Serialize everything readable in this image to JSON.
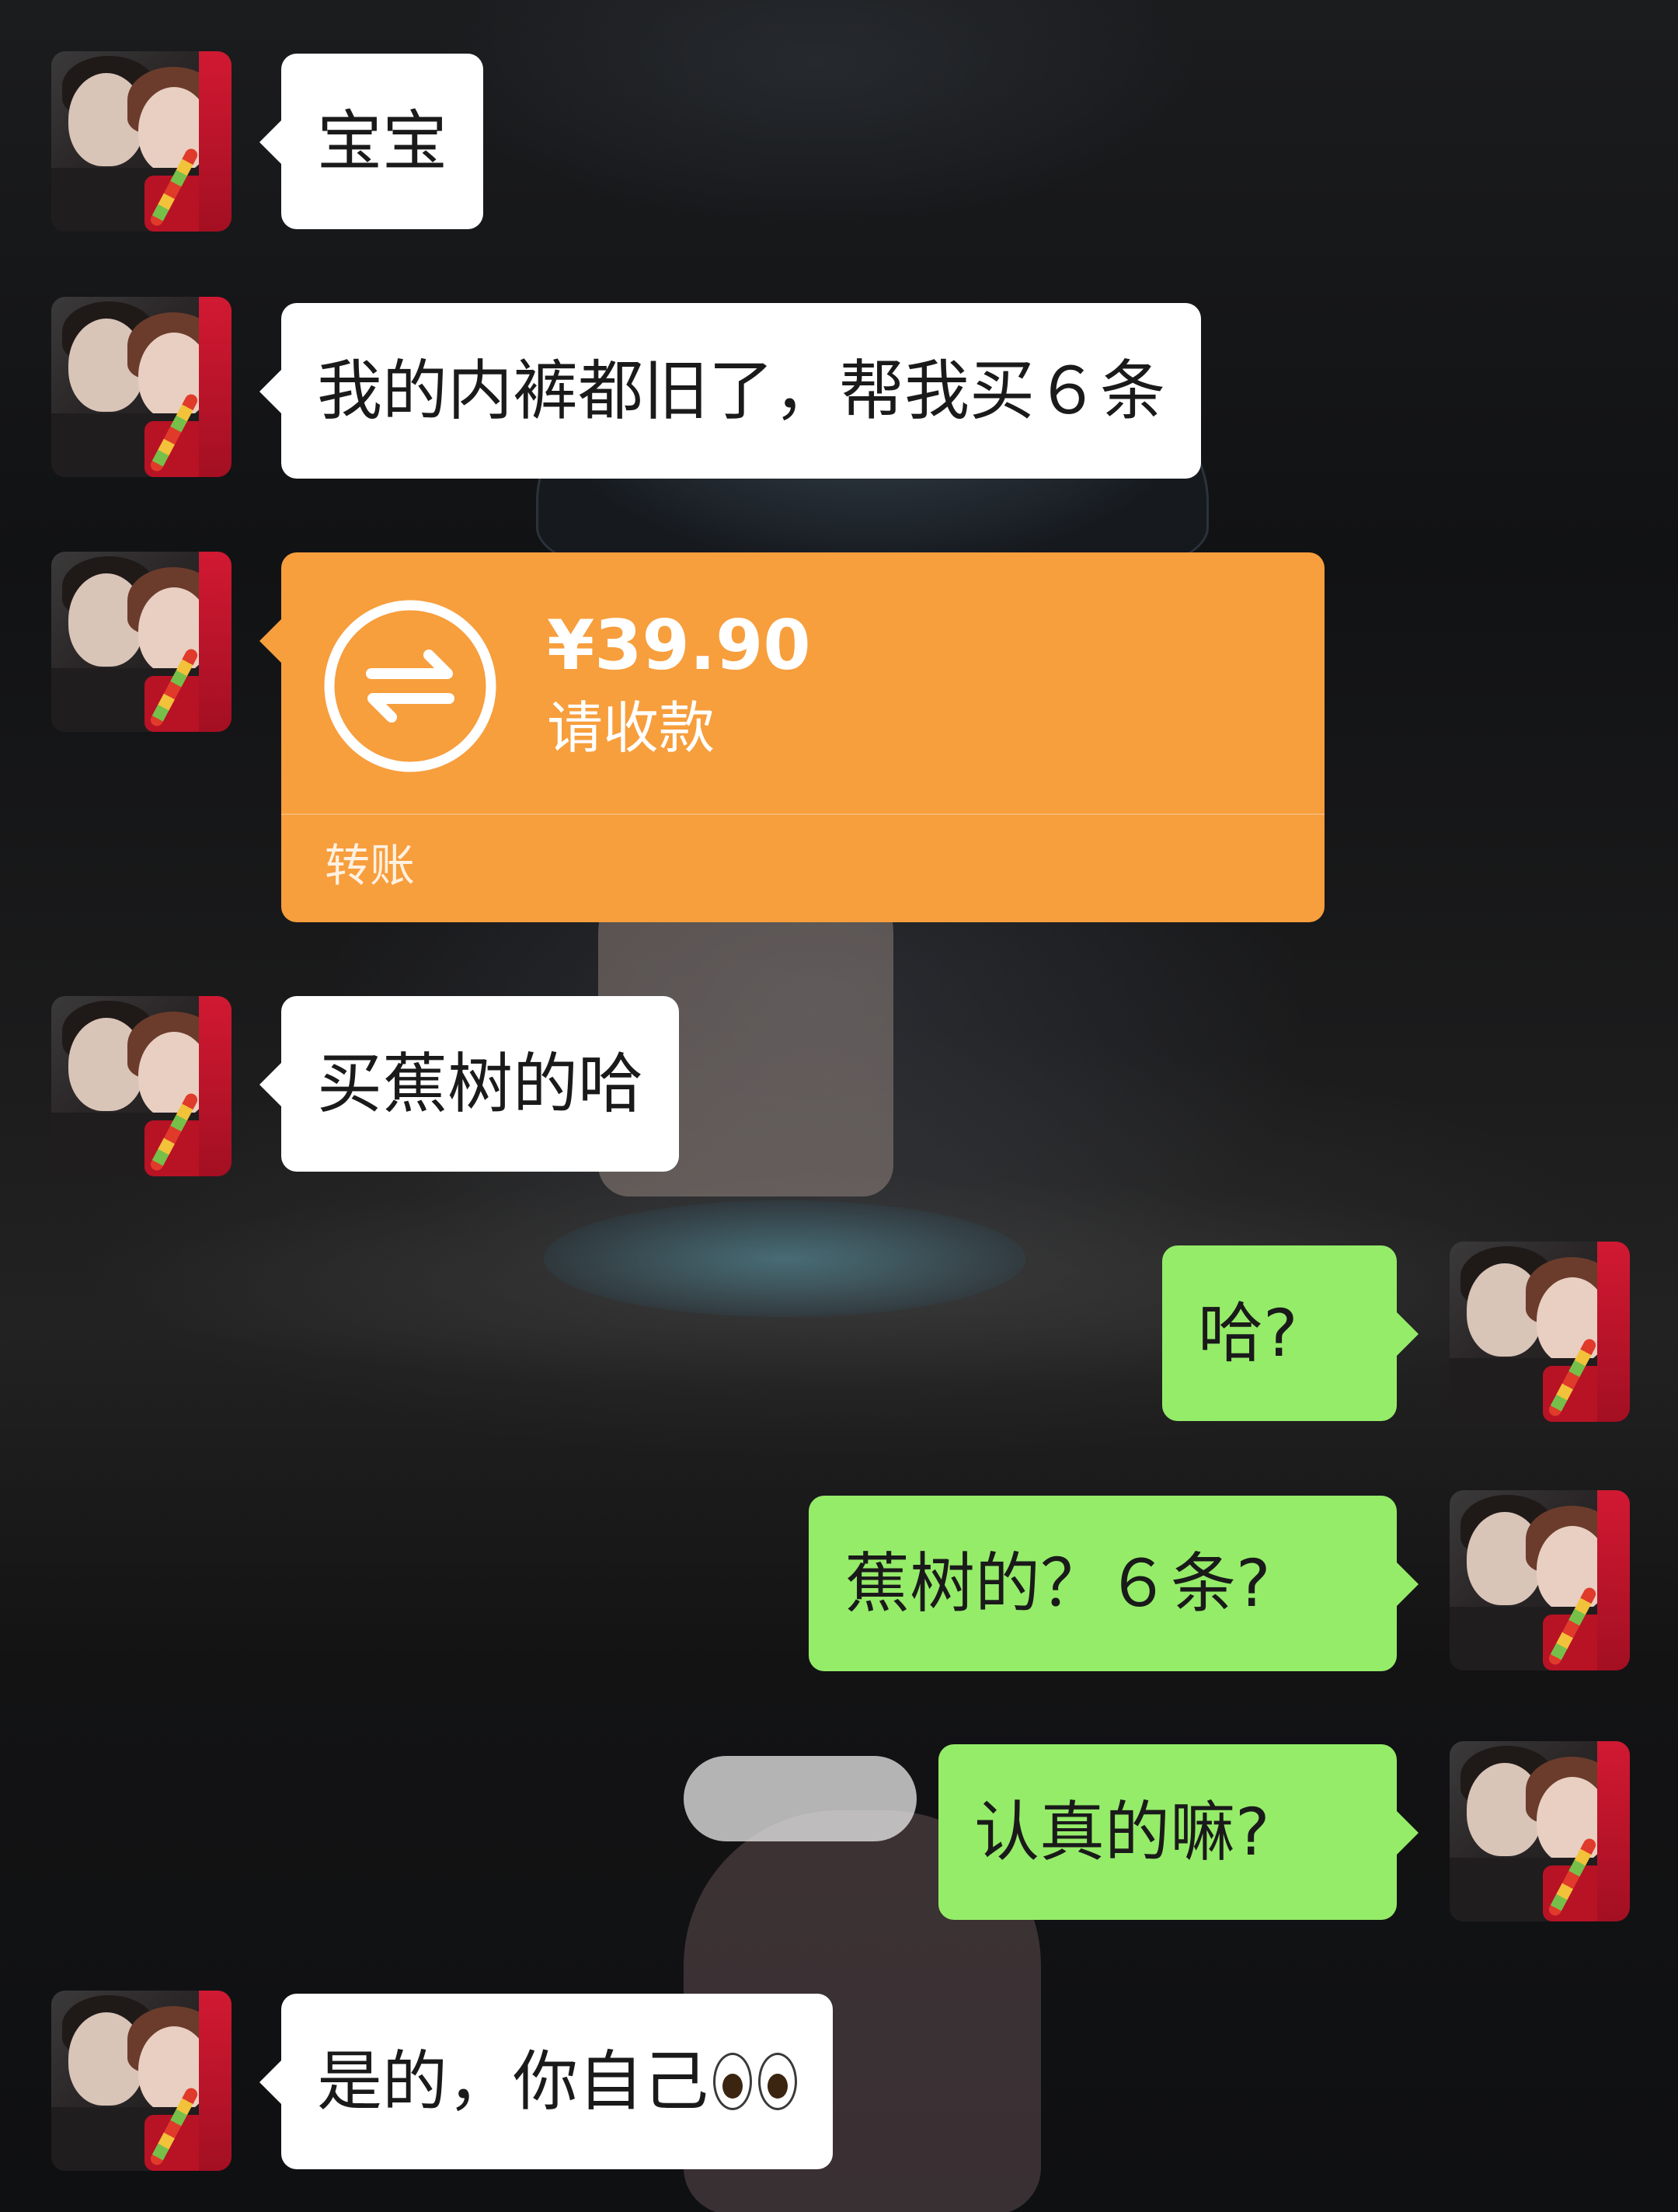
{
  "colors": {
    "incoming_bubble": "#ffffff",
    "outgoing_bubble": "#95ec69",
    "transfer_card": "#f79e3d"
  },
  "messages": [
    {
      "side": "left",
      "text": "宝宝"
    },
    {
      "side": "left",
      "text": "我的内裤都旧了，帮我买６条"
    },
    {
      "side": "left",
      "type": "transfer",
      "amount": "¥39.90",
      "status": "请收款",
      "label": "转账",
      "icon": "transfer-arrows-icon"
    },
    {
      "side": "left",
      "text": "买蕉树的哈"
    },
    {
      "side": "right",
      "text": "哈?"
    },
    {
      "side": "right",
      "text": "蕉树的？６条?"
    },
    {
      "side": "right",
      "text": "认真的嘛?"
    },
    {
      "side": "left",
      "text": "是的，你自己",
      "emoji": "eyes-emoji"
    }
  ]
}
